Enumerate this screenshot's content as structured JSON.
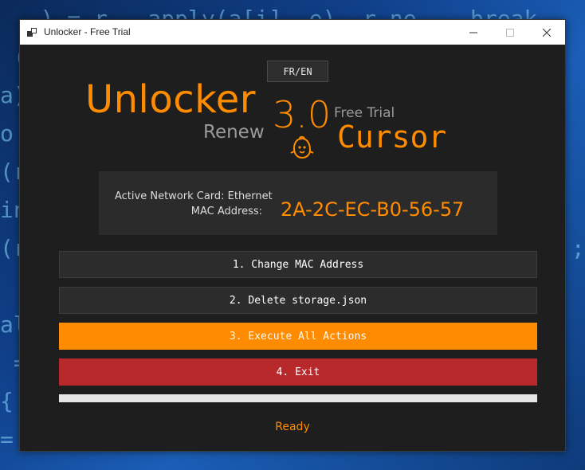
{
  "window": {
    "title": "Unlocker - Free Trial"
  },
  "header": {
    "lang_button": "FR/EN",
    "logo_main": "Unlocker",
    "logo_sub": "Renew",
    "version": "3.0",
    "edition": "Free Trial",
    "product": "Cursor"
  },
  "info": {
    "network_card_label": "Active Network Card: Ethernet",
    "mac_label": "MAC Address:",
    "mac_value": "2A-2C-EC-B0-56-57"
  },
  "actions": [
    {
      "label": "1. Change MAC Address"
    },
    {
      "label": "2. Delete storage.json"
    },
    {
      "label": "3. Execute All Actions"
    },
    {
      "label": "4. Exit"
    }
  ],
  "progress": {
    "value": 0
  },
  "status": "Ready",
  "colors": {
    "accent": "#ff8c00",
    "danger": "#b8292b",
    "panel": "#1e1e1e"
  },
  "icons": {
    "app": "app-window-icon",
    "mascot": "ghost-mascot-icon"
  }
}
